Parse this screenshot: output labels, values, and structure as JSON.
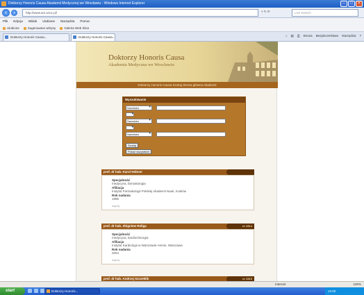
{
  "window": {
    "title": "Doktorzy Honoris Causa Akademii Medycznej we Wrocławiu - Windows Internet Explorer"
  },
  "address_bar": {
    "url": "http://www.am.wroc.pl/",
    "actions": "× ↻ ⟳",
    "search_placeholder": "Live Search"
  },
  "menu": [
    "Plik",
    "Edycja",
    "Widok",
    "Ulubione",
    "Narzędzia",
    "Pomoc"
  ],
  "links": [
    "Ulubione",
    "Sugerowane witryny",
    "Galeria Web Slice"
  ],
  "tabs": [
    {
      "label": "Doktorzy Honoris Causa..."
    },
    {
      "label": "Doktorzy Honoris Causa..."
    }
  ],
  "toolbar_right": [
    "Strona",
    "Bezpieczeństwo",
    "Narzędzia",
    "?"
  ],
  "banner": {
    "title": "Doktorzy Honoris Causa",
    "subtitle": "Akademia Medyczna we Wrocławiu"
  },
  "nav_strip": "Doktorzy Honoris Causa   Szukaj   Strona główna Akademii",
  "search_panel": {
    "heading": "Wyszukiwanie",
    "rows": [
      {
        "field": "Nazwisko"
      },
      {
        "field": "Nazwisko"
      },
      {
        "field": "Nazwisko"
      }
    ],
    "search_button": "Szukaj",
    "all_button": "Pokaż wszystkich"
  },
  "cards": [
    {
      "name": "prof. dr hab. Karol Hübner",
      "date": "",
      "discipline_label": "Specjalność",
      "discipline": "medycyna, farmakologia",
      "affiliation_label": "Afiliacja",
      "affiliation": "Instytut Farmakologii Polskiej Akademii Nauk, Kraków",
      "year_label": "Rok nadania",
      "year": "1996",
      "more": "więcej"
    },
    {
      "name": "prof. dr hab. Zbigniew Religa",
      "date": "nr 2814",
      "discipline_label": "Specjalność",
      "discipline": "medycyna, kardiochirurgia",
      "affiliation_label": "Afiliacja",
      "affiliation": "Instytut Kardiologii w Warszawie-Aninie, Warszawa",
      "year_label": "Rok nadania",
      "year": "2004",
      "more": "więcej"
    },
    {
      "name": "prof. dr hab. Andrzej Szczeklik",
      "date": "nr 2815"
    }
  ],
  "status": {
    "zone": "Internet",
    "zoom": "100%"
  },
  "taskbar": {
    "start": "start",
    "task": "Doktorzy Honoris...",
    "clock": "12:00"
  }
}
